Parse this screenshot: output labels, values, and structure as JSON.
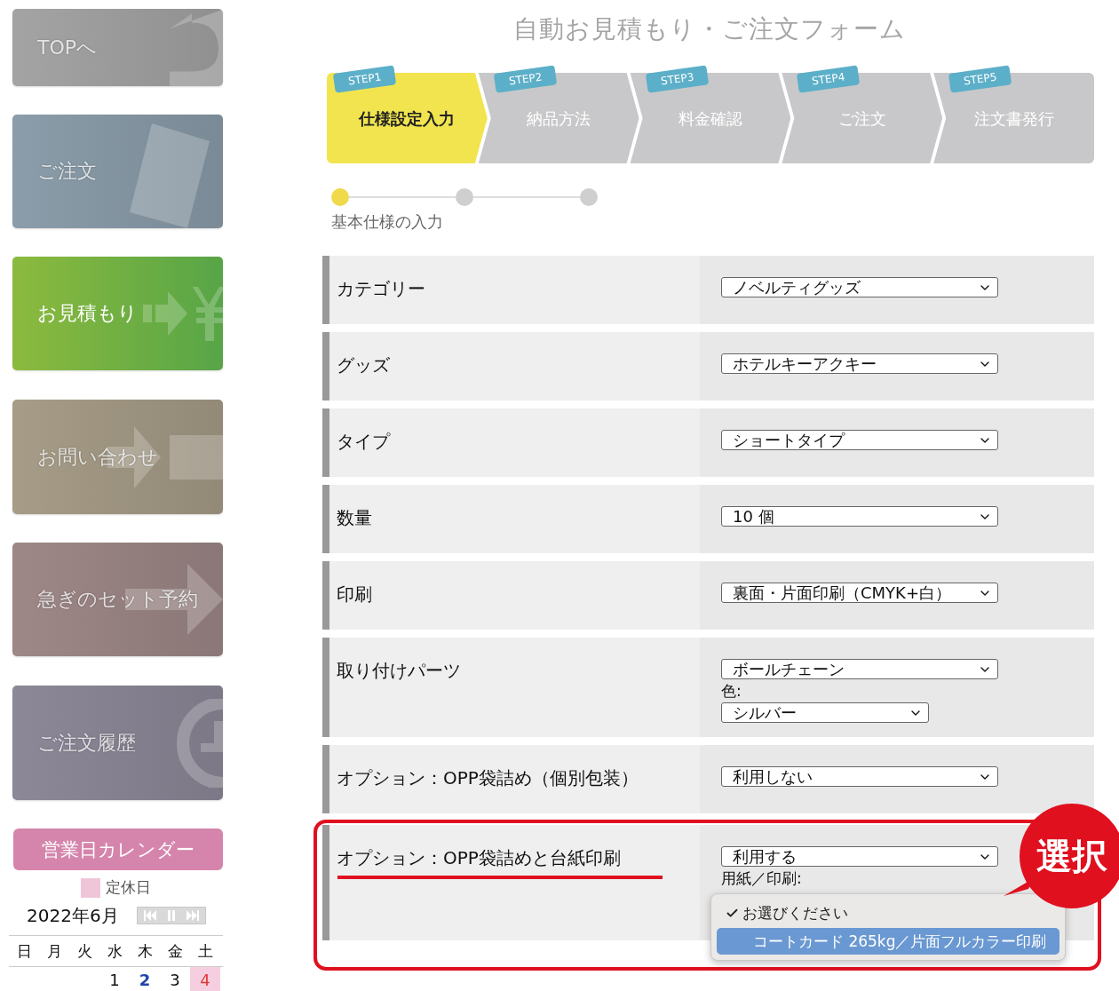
{
  "sidebar": {
    "nav": [
      {
        "label": "TOPへ",
        "selected": false,
        "color": "#a4a4a4"
      },
      {
        "label": "ご注文",
        "selected": false,
        "color": "#8b9daa"
      },
      {
        "label": "お見積もり",
        "selected": true,
        "color": "#8cba3e"
      },
      {
        "label": "お問い合わせ",
        "selected": false,
        "color": "#a69c87"
      },
      {
        "label": "急ぎのセット予約",
        "selected": false,
        "color": "#9e8787"
      },
      {
        "label": "ご注文履歴",
        "selected": false,
        "color": "#8d8898"
      }
    ],
    "calendar": {
      "title": "営業日カレンダー",
      "legend": "定休日",
      "month": "2022年6月",
      "weekdays": [
        "日",
        "月",
        "火",
        "水",
        "木",
        "金",
        "土"
      ],
      "weeks": [
        [
          {
            "kind": "blank"
          },
          {
            "kind": "blank"
          },
          {
            "kind": "blank"
          },
          {
            "kind": "day",
            "day": "1",
            "today": false,
            "holiday": false
          },
          {
            "kind": "day",
            "day": "2",
            "today": true,
            "holiday": false
          },
          {
            "kind": "day",
            "day": "3",
            "today": false,
            "holiday": false
          },
          {
            "kind": "day",
            "day": "4",
            "today": false,
            "holiday": true
          }
        ]
      ]
    }
  },
  "title": "自動お見積もり・ご注文フォーム",
  "steps": [
    {
      "tag": "STEP1",
      "label": "仕様設定入力",
      "selected": true
    },
    {
      "tag": "STEP2",
      "label": "納品方法",
      "selected": false
    },
    {
      "tag": "STEP3",
      "label": "料金確認",
      "selected": false
    },
    {
      "tag": "STEP4",
      "label": "ご注文",
      "selected": false
    },
    {
      "tag": "STEP5",
      "label": "注文書発行",
      "selected": false
    }
  ],
  "progress": {
    "dots": [
      {
        "selected": true
      },
      {
        "selected": false
      },
      {
        "selected": false
      }
    ],
    "label": "基本仕様の入力"
  },
  "form": [
    {
      "label": "カテゴリー",
      "highlighted": false,
      "fields": [
        {
          "kind": "select",
          "value": "ノベルティグッズ"
        }
      ]
    },
    {
      "label": "グッズ",
      "highlighted": false,
      "fields": [
        {
          "kind": "select",
          "value": "ホテルキーアクキー"
        }
      ]
    },
    {
      "label": "タイプ",
      "highlighted": false,
      "fields": [
        {
          "kind": "select",
          "value": "ショートタイプ"
        }
      ]
    },
    {
      "label": "数量",
      "highlighted": false,
      "fields": [
        {
          "kind": "select",
          "value": "10 個"
        }
      ]
    },
    {
      "label": "印刷",
      "highlighted": false,
      "fields": [
        {
          "kind": "select",
          "value": "裏面・片面印刷（CMYK+白）"
        }
      ]
    },
    {
      "label": "取り付けパーツ",
      "highlighted": false,
      "fields": [
        {
          "kind": "select",
          "value": "ボールチェーン"
        },
        {
          "kind": "caption",
          "value": "色:"
        },
        {
          "kind": "small-select",
          "value": "シルバー"
        }
      ]
    },
    {
      "label": "オプション：OPP袋詰め（個別包装）",
      "highlighted": false,
      "fields": [
        {
          "kind": "select",
          "value": "利用しない"
        }
      ]
    },
    {
      "label": "オプション：OPP袋詰めと台紙印刷",
      "highlighted": true,
      "fields": [
        {
          "kind": "select",
          "value": "利用する"
        },
        {
          "kind": "caption",
          "value": "用紙／印刷:"
        },
        {
          "kind": "menu",
          "options": [
            {
              "label": "お選びください",
              "checked": true,
              "selected": false
            },
            {
              "label": "コートカード 265kg／片面フルカラー印刷",
              "checked": false,
              "selected": true
            }
          ]
        }
      ]
    }
  ],
  "callout": "選択"
}
